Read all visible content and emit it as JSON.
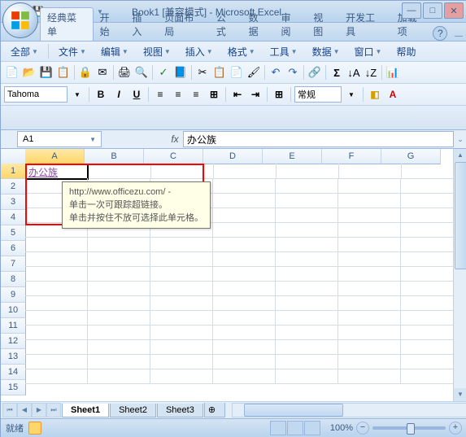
{
  "title": "Book1 [兼容模式] - Microsoft Excel",
  "qat_icons": [
    "save",
    "undo",
    "redo",
    "sep",
    "print",
    "more"
  ],
  "tabs": [
    "经典菜单",
    "开始",
    "插入",
    "页面布局",
    "公式",
    "数据",
    "审阅",
    "视图",
    "开发工具",
    "加载项"
  ],
  "active_tab": 0,
  "menu": {
    "all": "全部",
    "file": "文件",
    "edit": "编辑",
    "view": "视图",
    "insert": "插入",
    "format": "格式",
    "tools": "工具",
    "data": "数据",
    "window": "窗口",
    "help": "帮助"
  },
  "font_name": "Tahoma",
  "format_label": "常规",
  "namebox": "A1",
  "fx": "办公族",
  "columns": [
    "A",
    "B",
    "C",
    "D",
    "E",
    "F",
    "G"
  ],
  "rows": [
    "1",
    "2",
    "3",
    "4",
    "5",
    "6",
    "7",
    "8",
    "9",
    "10",
    "11",
    "12",
    "13",
    "14",
    "15"
  ],
  "cell_a1": "办公族",
  "tooltip": {
    "line1": "http://www.officezu.com/ -",
    "line2": "单击一次可跟踪超链接。",
    "line3": "单击并按住不放可选择此单元格。"
  },
  "sheets": [
    "Sheet1",
    "Sheet2",
    "Sheet3"
  ],
  "status": "就绪",
  "zoom": "100%"
}
